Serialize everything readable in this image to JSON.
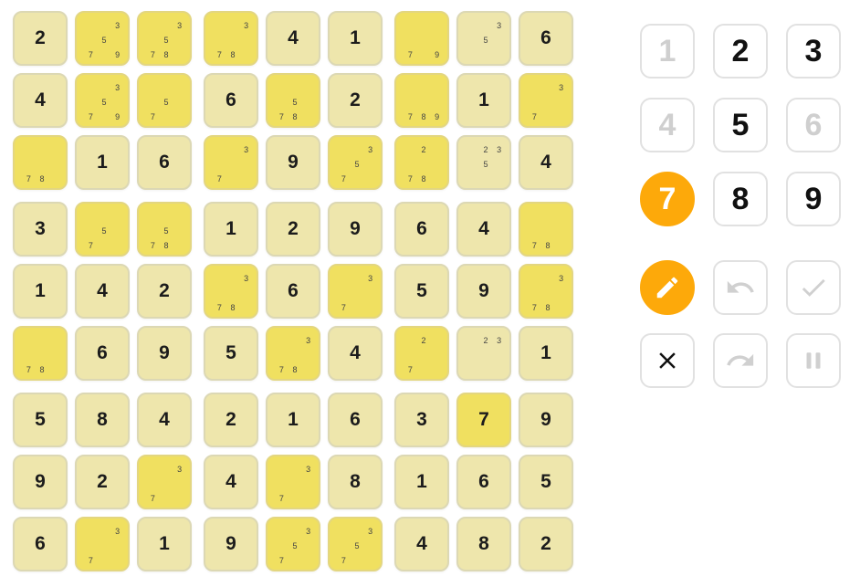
{
  "board": {
    "rows": [
      [
        {
          "v": "2"
        },
        {
          "n": [
            "3",
            "5",
            "7",
            "9"
          ],
          "hl": true
        },
        {
          "n": [
            "3",
            "5",
            "7",
            "8"
          ],
          "hl": true
        },
        {
          "n": [
            "3",
            "7",
            "8"
          ],
          "hl": true
        },
        {
          "v": "4"
        },
        {
          "v": "1"
        },
        {
          "n": [
            "7",
            "9"
          ],
          "hl": true
        },
        {
          "n": [
            "3",
            "5"
          ]
        },
        {
          "v": "6"
        }
      ],
      [
        {
          "v": "4"
        },
        {
          "n": [
            "3",
            "5",
            "7",
            "9"
          ],
          "hl": true
        },
        {
          "n": [
            "5",
            "7"
          ],
          "hl": true
        },
        {
          "v": "6"
        },
        {
          "n": [
            "5",
            "7",
            "8"
          ],
          "hl": true
        },
        {
          "v": "2"
        },
        {
          "n": [
            "7",
            "8",
            "9"
          ],
          "hl": true
        },
        {
          "v": "1"
        },
        {
          "n": [
            "3",
            "7"
          ],
          "hl": true
        }
      ],
      [
        {
          "n": [
            "7",
            "8"
          ],
          "hl": true
        },
        {
          "v": "1"
        },
        {
          "v": "6"
        },
        {
          "n": [
            "3",
            "7"
          ],
          "hl": true
        },
        {
          "v": "9"
        },
        {
          "n": [
            "3",
            "5",
            "7"
          ],
          "hl": true
        },
        {
          "n": [
            "2",
            "7",
            "8"
          ],
          "hl": true
        },
        {
          "n": [
            "2",
            "3",
            "5"
          ]
        },
        {
          "v": "4"
        }
      ],
      [
        {
          "v": "3"
        },
        {
          "n": [
            "5",
            "7"
          ],
          "hl": true
        },
        {
          "n": [
            "5",
            "7",
            "8"
          ],
          "hl": true
        },
        {
          "v": "1"
        },
        {
          "v": "2"
        },
        {
          "v": "9"
        },
        {
          "v": "6"
        },
        {
          "v": "4"
        },
        {
          "n": [
            "7",
            "8"
          ],
          "hl": true
        }
      ],
      [
        {
          "v": "1"
        },
        {
          "v": "4"
        },
        {
          "v": "2"
        },
        {
          "n": [
            "3",
            "7",
            "8"
          ],
          "hl": true
        },
        {
          "v": "6"
        },
        {
          "n": [
            "3",
            "7"
          ],
          "hl": true
        },
        {
          "v": "5"
        },
        {
          "v": "9"
        },
        {
          "n": [
            "3",
            "7",
            "8"
          ],
          "hl": true
        }
      ],
      [
        {
          "n": [
            "7",
            "8"
          ],
          "hl": true
        },
        {
          "v": "6"
        },
        {
          "v": "9"
        },
        {
          "v": "5"
        },
        {
          "n": [
            "3",
            "7",
            "8"
          ],
          "hl": true
        },
        {
          "v": "4"
        },
        {
          "n": [
            "2",
            "7"
          ],
          "hl": true
        },
        {
          "n": [
            "2",
            "3"
          ]
        },
        {
          "v": "1"
        }
      ],
      [
        {
          "v": "5"
        },
        {
          "v": "8"
        },
        {
          "v": "4"
        },
        {
          "v": "2"
        },
        {
          "v": "1"
        },
        {
          "v": "6"
        },
        {
          "v": "3"
        },
        {
          "v": "7",
          "hl": true
        },
        {
          "v": "9"
        }
      ],
      [
        {
          "v": "9"
        },
        {
          "v": "2"
        },
        {
          "n": [
            "3",
            "7"
          ],
          "hl": true
        },
        {
          "v": "4"
        },
        {
          "n": [
            "3",
            "7"
          ],
          "hl": true
        },
        {
          "v": "8"
        },
        {
          "v": "1"
        },
        {
          "v": "6"
        },
        {
          "v": "5"
        }
      ],
      [
        {
          "v": "6"
        },
        {
          "n": [
            "3",
            "7"
          ],
          "hl": true
        },
        {
          "v": "1"
        },
        {
          "v": "9"
        },
        {
          "n": [
            "3",
            "5",
            "7"
          ],
          "hl": true
        },
        {
          "n": [
            "3",
            "5",
            "7"
          ],
          "hl": true
        },
        {
          "v": "4"
        },
        {
          "v": "8"
        },
        {
          "v": "2"
        }
      ]
    ]
  },
  "keypad": {
    "digits": [
      {
        "label": "1",
        "state": "disabled"
      },
      {
        "label": "2",
        "state": "normal"
      },
      {
        "label": "3",
        "state": "normal"
      },
      {
        "label": "4",
        "state": "disabled"
      },
      {
        "label": "5",
        "state": "normal"
      },
      {
        "label": "6",
        "state": "disabled"
      },
      {
        "label": "7",
        "state": "selected"
      },
      {
        "label": "8",
        "state": "normal"
      },
      {
        "label": "9",
        "state": "normal"
      }
    ]
  },
  "tools": [
    {
      "icon": "pencil-icon",
      "state": "active"
    },
    {
      "icon": "undo-icon",
      "state": "disabled"
    },
    {
      "icon": "check-icon",
      "state": "disabled"
    },
    {
      "icon": "close-icon",
      "state": "normal"
    },
    {
      "icon": "redo-icon",
      "state": "disabled"
    },
    {
      "icon": "pause-icon",
      "state": "disabled"
    }
  ],
  "colors": {
    "accent": "#fda90a",
    "cell": "#eee6ac",
    "cell_highlight": "#f0e060",
    "disabled": "#cfcfcf"
  }
}
